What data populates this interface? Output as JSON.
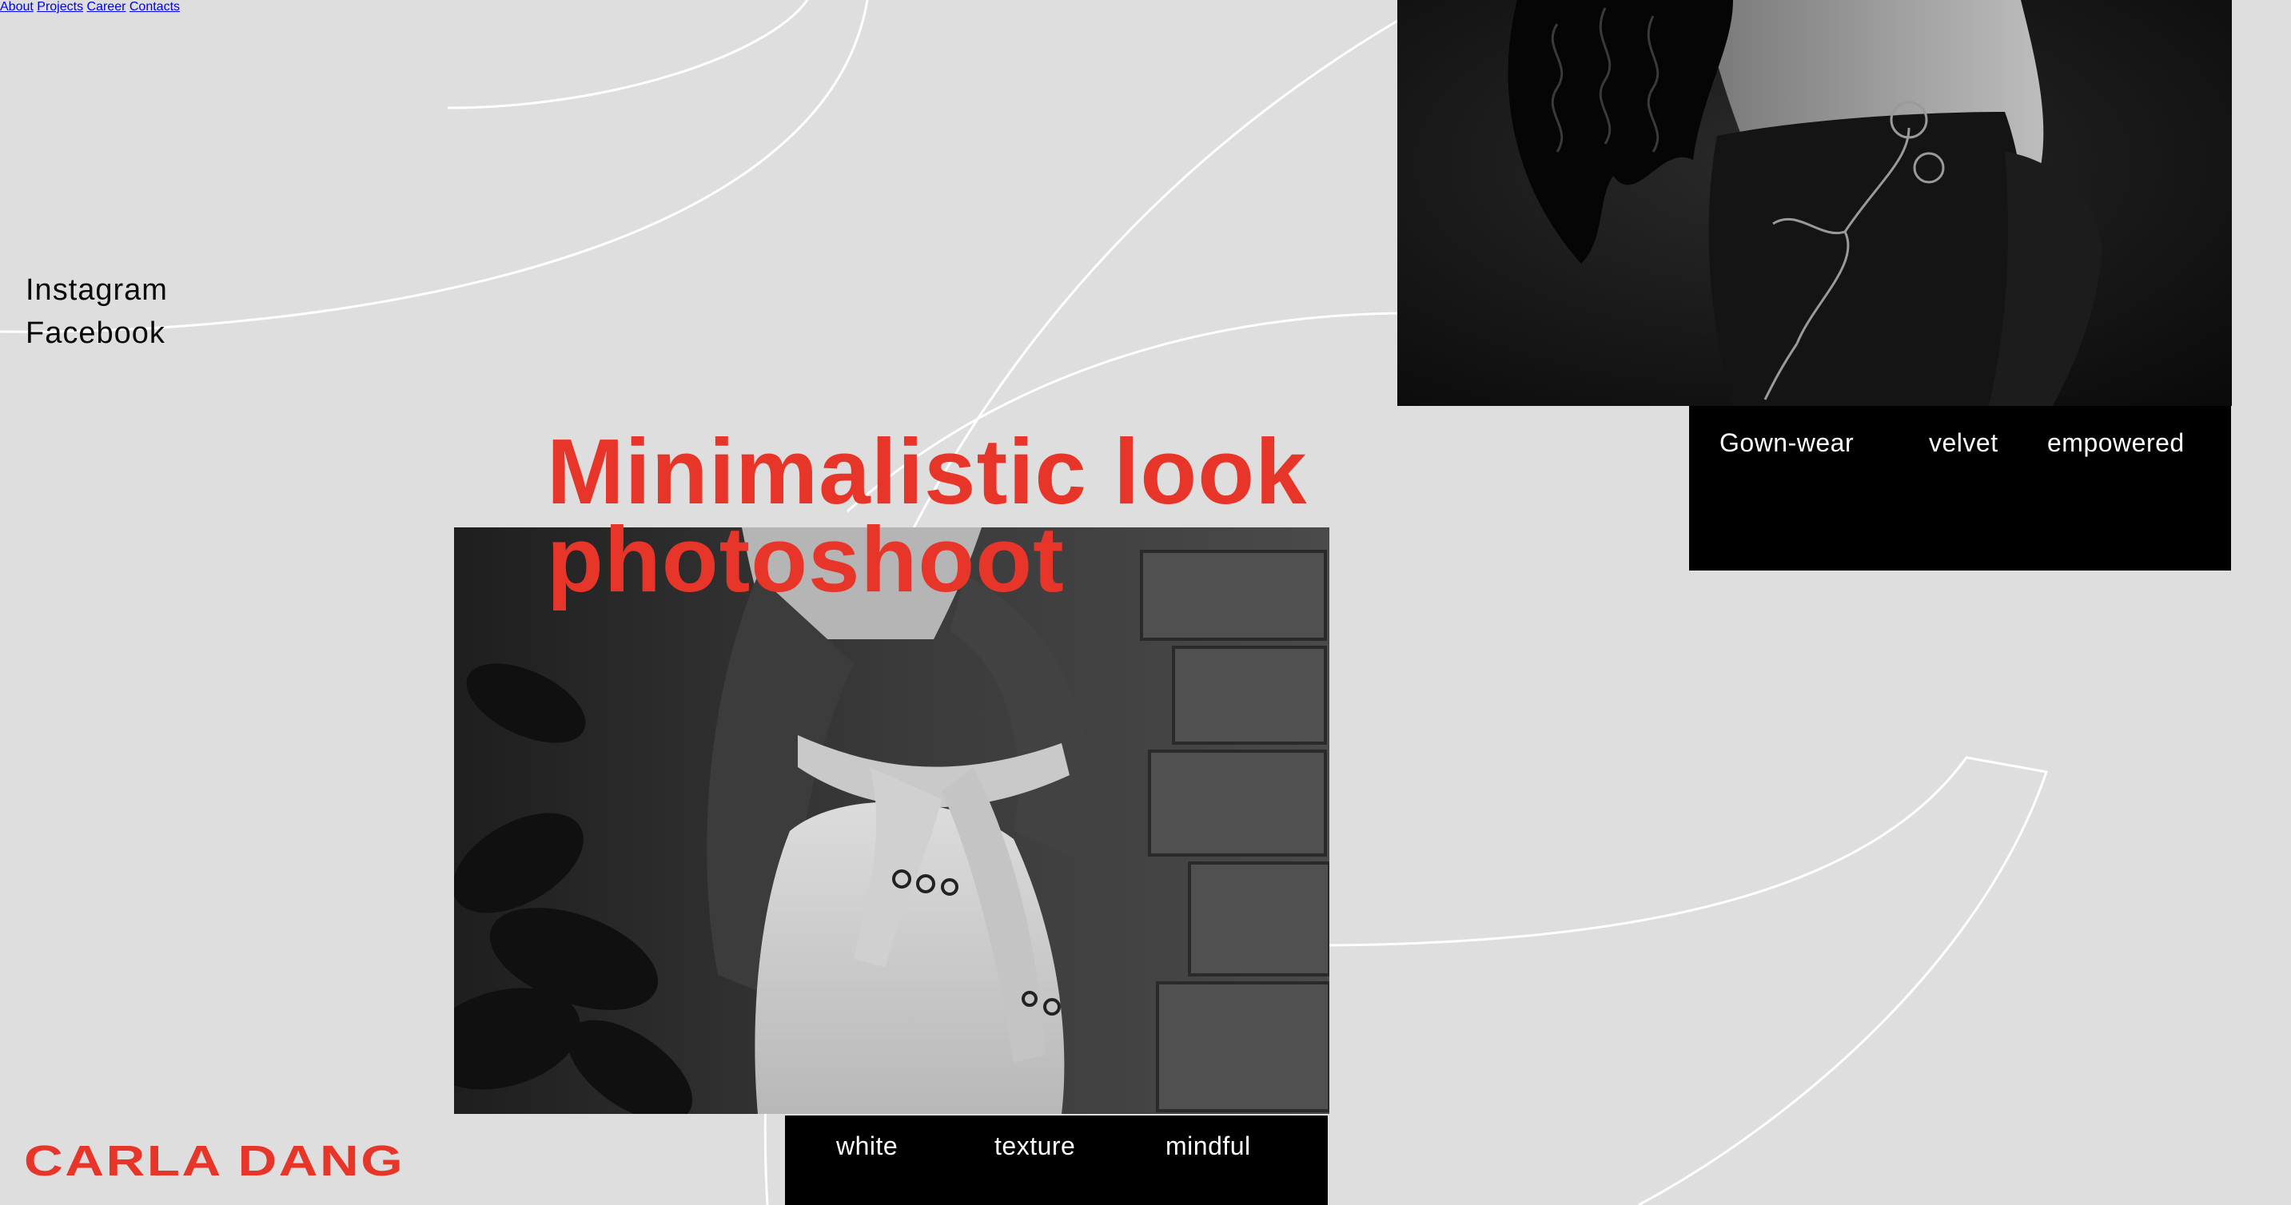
{
  "nav": {
    "main": [
      {
        "label": "About"
      },
      {
        "label": "Projects"
      },
      {
        "label": "Career"
      },
      {
        "label": "Contacts"
      }
    ],
    "social": [
      {
        "label": "Instagram"
      },
      {
        "label": "Facebook"
      }
    ]
  },
  "feature": {
    "title_line1": "Minimalistic look",
    "title_line2": "photoshoot"
  },
  "gown_tags": [
    "Gown-wear",
    "velvet",
    "empowered"
  ],
  "shoot_tags": [
    "white",
    "texture",
    "mindful"
  ],
  "logo_text": "CARLA DANG",
  "colors": {
    "background": "#dedede",
    "accent": "#e8352a",
    "panel": "#000000",
    "line": "#ffffff"
  }
}
